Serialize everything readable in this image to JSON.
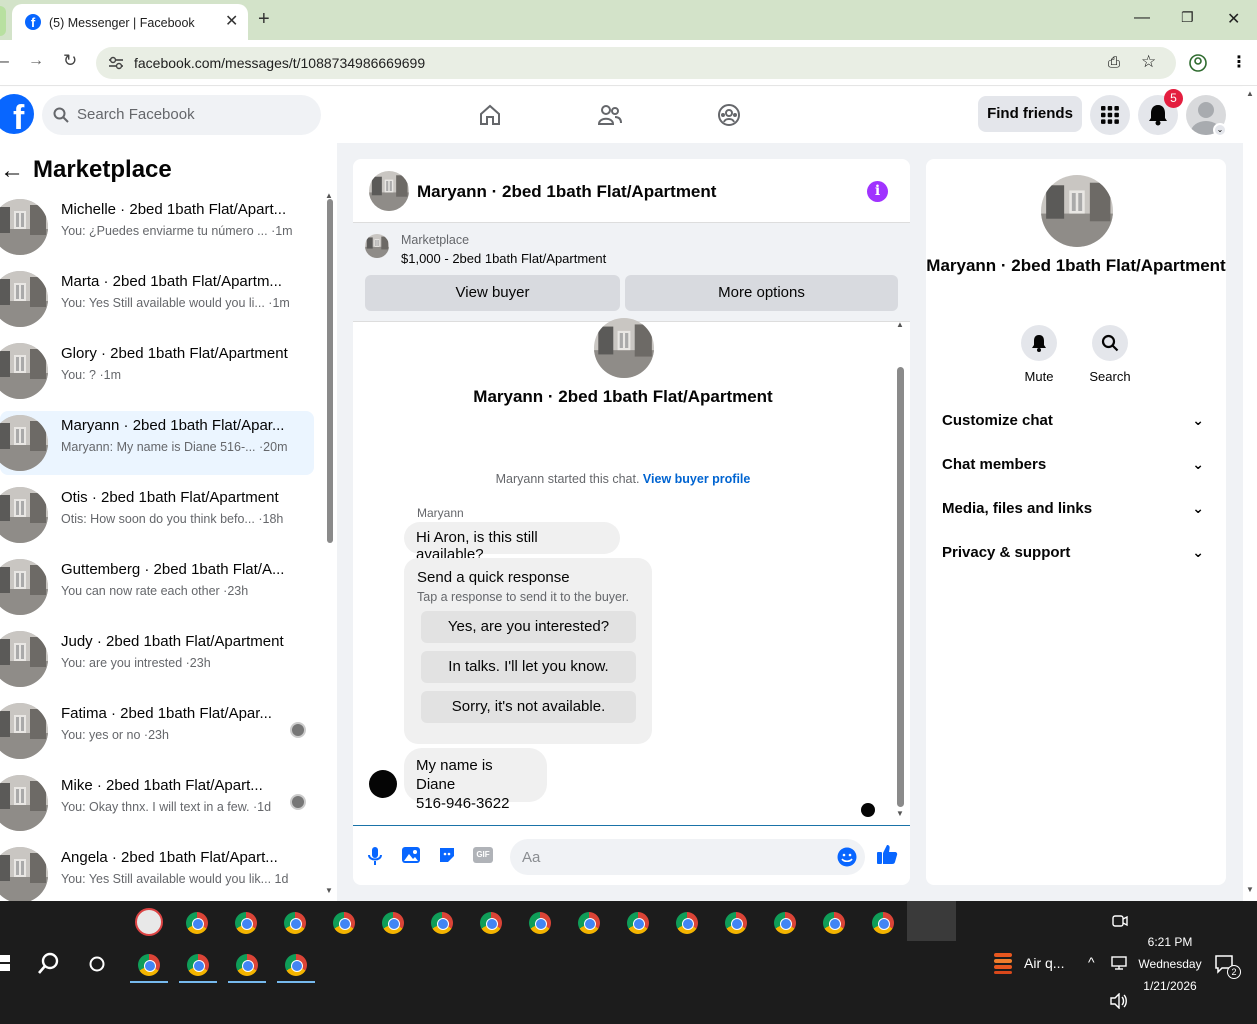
{
  "browser": {
    "tab_title": "(5) Messenger | Facebook",
    "url": "facebook.com/messages/t/1088734986669699"
  },
  "header": {
    "search_placeholder": "Search Facebook",
    "find_friends": "Find friends",
    "notification_count": "5"
  },
  "sidebar": {
    "title": "Marketplace",
    "conversations": [
      {
        "name": "Michelle · 2bed 1bath Flat/Apart...",
        "snippet": "You: ¿Puedes enviarme tu número ... ·1m"
      },
      {
        "name": "Marta · 2bed 1bath Flat/Apartm...",
        "snippet": "You: Yes Still available would you li... ·1m"
      },
      {
        "name": "Glory · 2bed 1bath Flat/Apartment",
        "snippet": "You: ? ·1m"
      },
      {
        "name": "Maryann · 2bed 1bath Flat/Apar...",
        "snippet": "Maryann: My name is Diane 516-... ·20m"
      },
      {
        "name": "Otis · 2bed 1bath Flat/Apartment",
        "snippet": "Otis: How soon do you think befo... ·18h"
      },
      {
        "name": "Guttemberg · 2bed 1bath Flat/A...",
        "snippet": "You can now rate each other ·23h"
      },
      {
        "name": "Judy · 2bed 1bath Flat/Apartment",
        "snippet": "You: are you intrested ·23h"
      },
      {
        "name": "Fatima · 2bed 1bath Flat/Apar...",
        "snippet": "You: yes or no ·23h"
      },
      {
        "name": "Mike · 2bed 1bath Flat/Apart...",
        "snippet": "You: Okay thnx. I will text in a few. ·1d"
      },
      {
        "name": "Angela · 2bed 1bath Flat/Apart...",
        "snippet": "You: Yes Still available would you lik... 1d"
      }
    ]
  },
  "chat": {
    "title": "Maryann · 2bed 1bath Flat/Apartment",
    "marketplace_label": "Marketplace",
    "listing": "$1,000 - 2bed 1bath Flat/Apartment",
    "view_buyer": "View buyer",
    "more_options": "More options",
    "started_text": "Maryann started this chat.",
    "view_buyer_profile": "View buyer profile",
    "sender": "Maryann",
    "message1": "Hi Aron, is this still available?",
    "quick_title": "Send a quick response",
    "quick_sub": "Tap a response to send it to the buyer.",
    "quick_responses": [
      "Yes, are you interested?",
      "In talks. I'll let you know.",
      "Sorry, it's not available."
    ],
    "message2_line1": "My name is Diane",
    "message2_line2": "516-946-3622",
    "input_placeholder": "Aa"
  },
  "details": {
    "name": "Maryann · 2bed 1bath Flat/Apartment",
    "mute": "Mute",
    "search": "Search",
    "rows": [
      "Customize chat",
      "Chat members",
      "Media, files and links",
      "Privacy & support"
    ]
  },
  "taskbar": {
    "time": "6:21 PM",
    "day": "Wednesday",
    "date": "1/21/2026",
    "weather": "Air q...",
    "notif_count": "2"
  },
  "colors": {
    "fb_blue": "#0866ff",
    "info_purple": "#a033ff",
    "active_row": "#ebf5ff"
  }
}
